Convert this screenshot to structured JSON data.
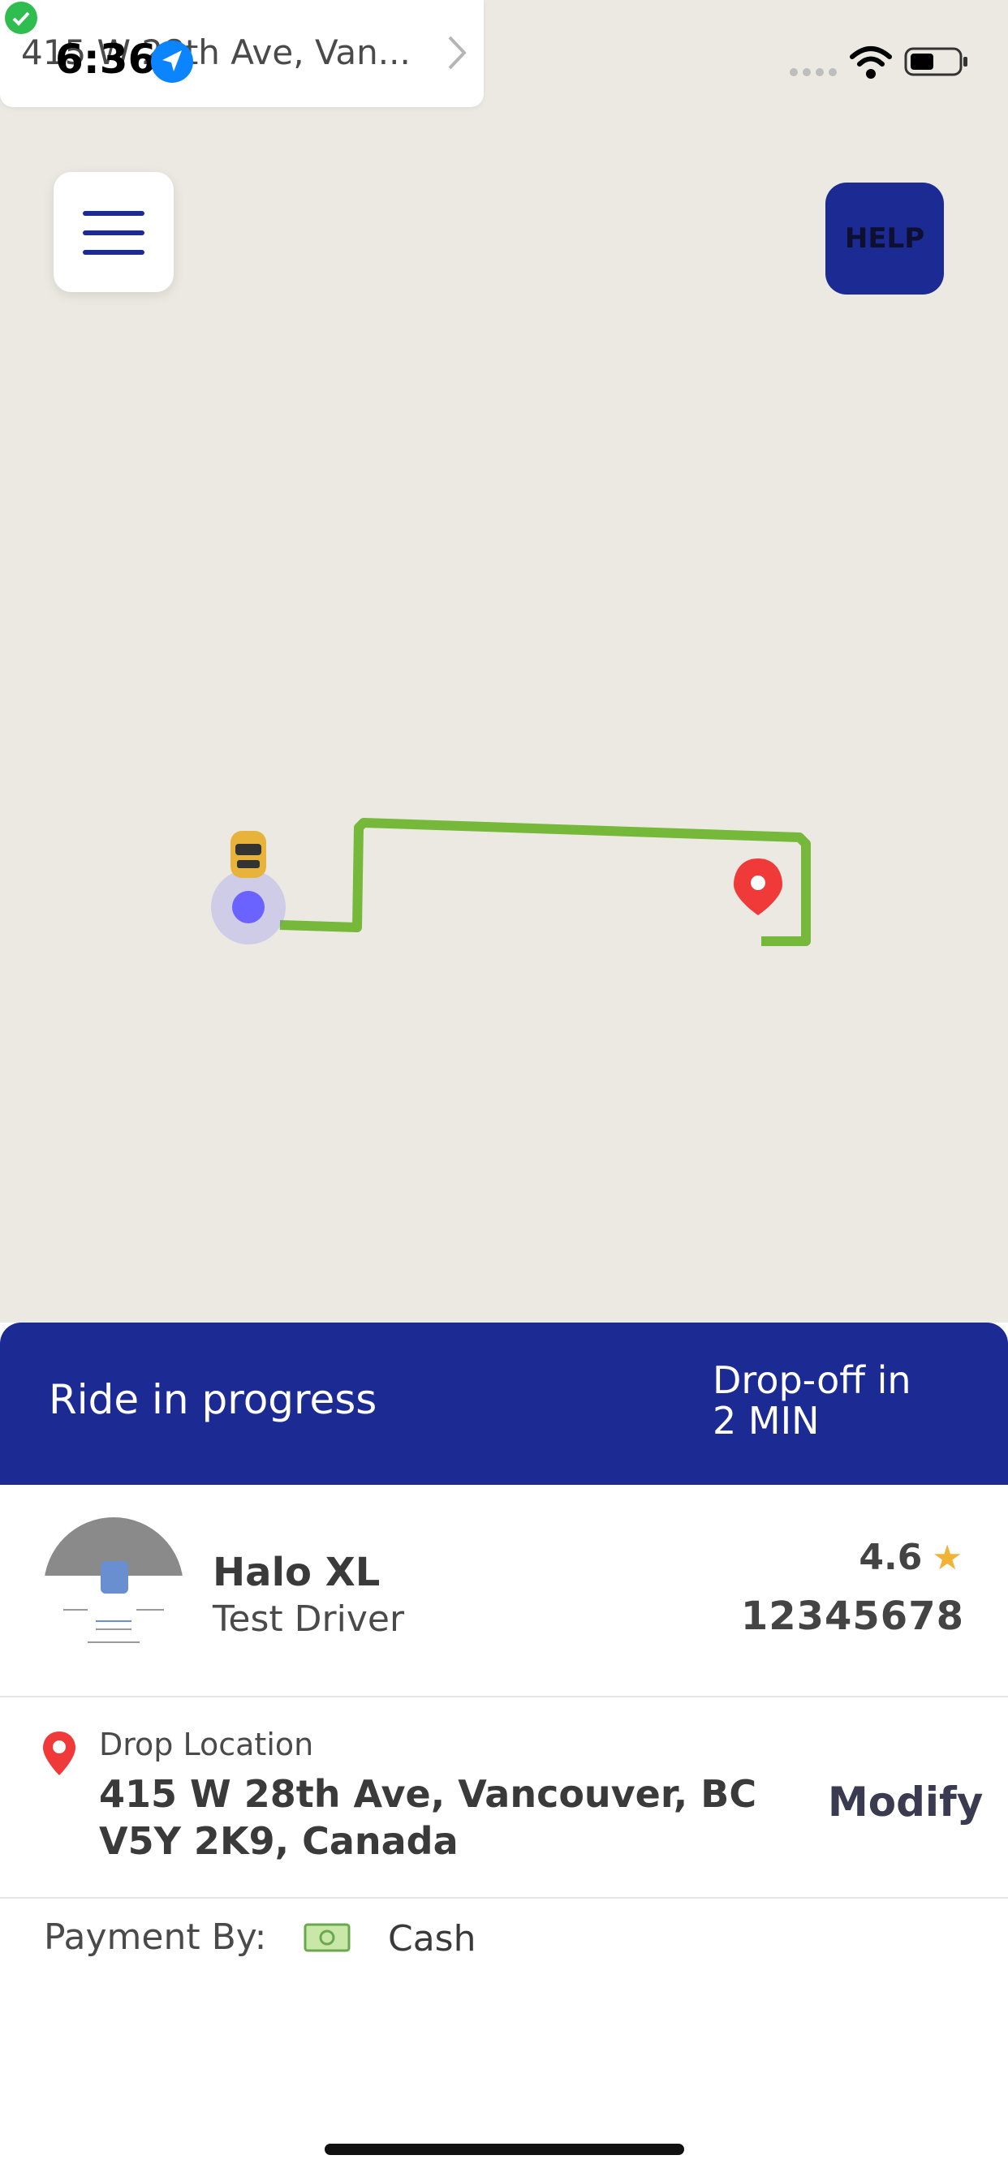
{
  "status_bar": {
    "time": "6:36",
    "notification_text": "415 W 28th Ave, Van..."
  },
  "map": {
    "help_label": "HELP",
    "route_color": "#76b83a",
    "user_dot_color": "#6b63ff",
    "destination_pin_color": "#f03a3a"
  },
  "ride": {
    "status": "Ride in progress",
    "dropoff_line1": "Drop-off in",
    "dropoff_line2": "2 MIN",
    "header_color": "#1c2a94"
  },
  "driver": {
    "vehicle": "Halo XL",
    "name": "Test Driver",
    "rating": "4.6",
    "star": "★",
    "plate": "12345678"
  },
  "drop": {
    "label": "Drop Location",
    "address": "415 W 28th Ave, Vancouver, BC V5Y 2K9, Canada",
    "modify_label": "Modify"
  },
  "payment": {
    "label": "Payment By:",
    "method": "Cash",
    "icon": "cash-icon"
  }
}
